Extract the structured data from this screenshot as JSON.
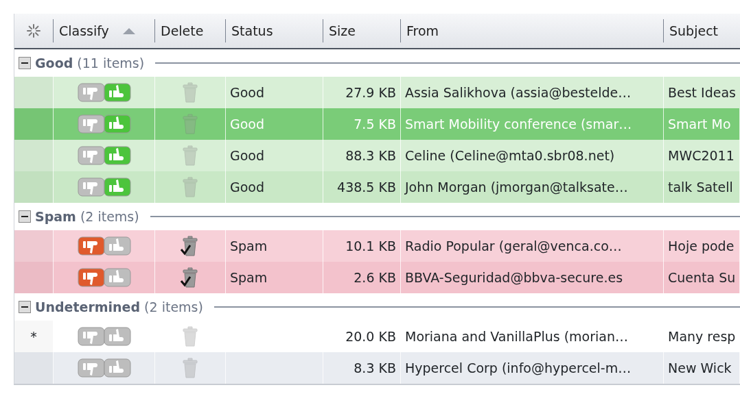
{
  "table": {
    "columns": [
      {
        "label": "Classify",
        "sorted": true
      },
      {
        "label": "Delete"
      },
      {
        "label": "Status"
      },
      {
        "label": "Size"
      },
      {
        "label": "From"
      },
      {
        "label": "Subject"
      }
    ],
    "groups": [
      {
        "label": "Good",
        "count": "(11 items)",
        "expanded": true,
        "rows": [
          {
            "marker": "",
            "kind": "good",
            "delete_checked": false,
            "selected": false,
            "status": "Good",
            "size": "27.9 KB",
            "from": "Assia Salikhova (assia@bestelde…",
            "subject": "Best Ideas"
          },
          {
            "marker": "",
            "kind": "good",
            "delete_checked": false,
            "selected": true,
            "status": "Good",
            "size": "7.5 KB",
            "from": "Smart Mobility conference (smar…",
            "subject": "Smart Mo"
          },
          {
            "marker": "",
            "kind": "good",
            "delete_checked": false,
            "selected": false,
            "status": "Good",
            "size": "88.3 KB",
            "from": "Celine (Celine@mta0.sbr08.net)",
            "subject": "MWC2011"
          },
          {
            "marker": "",
            "kind": "good",
            "delete_checked": false,
            "selected": false,
            "status": "Good",
            "size": "438.5 KB",
            "from": "John Morgan (jmorgan@talksate…",
            "subject": "talk Satell"
          }
        ]
      },
      {
        "label": "Spam",
        "count": "(2 items)",
        "expanded": true,
        "rows": [
          {
            "marker": "",
            "kind": "spam",
            "delete_checked": true,
            "selected": false,
            "status": "Spam",
            "size": "10.1 KB",
            "from": "Radio Popular (geral@venca.co…",
            "subject": "Hoje pode"
          },
          {
            "marker": "",
            "kind": "spam",
            "delete_checked": true,
            "selected": false,
            "status": "Spam",
            "size": "2.6 KB",
            "from": "BBVA-Seguridad@bbva-secure.es",
            "subject": "Cuenta Su"
          }
        ]
      },
      {
        "label": "Undetermined",
        "count": "(2 items)",
        "expanded": true,
        "rows": [
          {
            "marker": "*",
            "kind": "none",
            "delete_checked": false,
            "selected": false,
            "status": "",
            "size": "20.0 KB",
            "from": "Moriana and VanillaPlus (morian…",
            "subject": "Many resp"
          },
          {
            "marker": "",
            "kind": "none",
            "delete_checked": false,
            "selected": false,
            "status": "",
            "size": "8.3 KB",
            "from": "Hypercel Corp (info@hypercel-m…",
            "subject": "New Wick"
          }
        ]
      }
    ]
  }
}
